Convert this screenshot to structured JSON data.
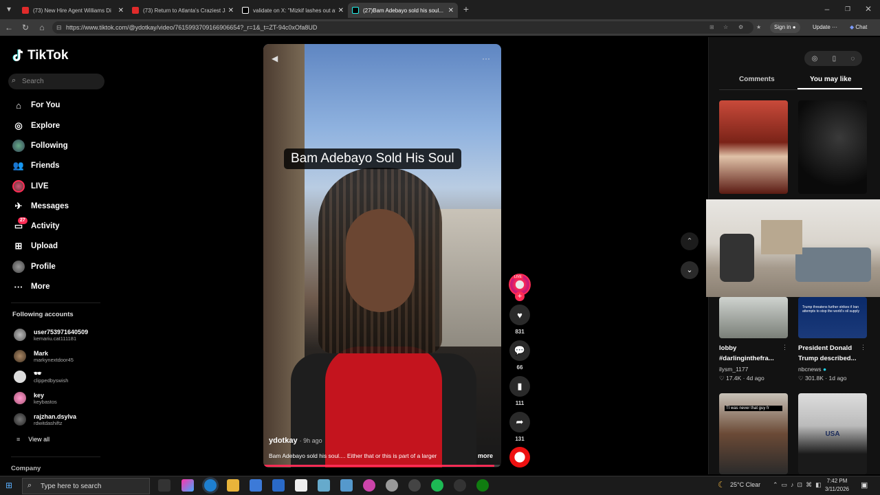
{
  "browser": {
    "tabs": [
      {
        "label": "(73) New Hire Agent Williams Di",
        "color": "#e02b2b"
      },
      {
        "label": "(73) Return to Atlanta's Craziest Ja",
        "color": "#e02b2b"
      },
      {
        "label": "validate on X: \"Mizkif lashes out at",
        "color": "#ffffff"
      },
      {
        "label": "(27)Bam Adebayo sold his soul...",
        "color": "#25f4ee"
      }
    ],
    "url": "https://www.tiktok.com/@ydotkay/video/7615993709166906654?_r=1&_t=ZT-94c0xOfa8UD",
    "signin": "Sign in",
    "update": "Update",
    "chat": "Chat"
  },
  "sidebar": {
    "logo": "TikTok",
    "search_placeholder": "Search",
    "nav": [
      {
        "label": "For You",
        "icon": "home-icon"
      },
      {
        "label": "Explore",
        "icon": "compass-icon"
      },
      {
        "label": "Following",
        "icon": "following-avatar-icon"
      },
      {
        "label": "Friends",
        "icon": "friends-icon"
      },
      {
        "label": "LIVE",
        "icon": "live-icon"
      },
      {
        "label": "Messages",
        "icon": "messages-icon"
      },
      {
        "label": "Activity",
        "icon": "activity-icon",
        "badge": "27"
      },
      {
        "label": "Upload",
        "icon": "upload-icon"
      },
      {
        "label": "Profile",
        "icon": "profile-icon"
      },
      {
        "label": "More",
        "icon": "more-icon"
      }
    ],
    "following_title": "Following accounts",
    "accounts": [
      {
        "name": "user7539716405​09",
        "handle": "kemariu.cat111181"
      },
      {
        "name": "Mark",
        "handle": "markynextdoor45"
      },
      {
        "name": "🕶",
        "handle": "clippedbyswish"
      },
      {
        "name": "key",
        "handle": "keybastos"
      },
      {
        "name": "rajzhan.dsylva",
        "handle": "rdwitdashiftz"
      }
    ],
    "view_all": "View all",
    "company": "Company"
  },
  "video": {
    "caption_overlay": "Bam Adebayo Sold His Soul",
    "author": "ydotkay",
    "time": "· 9h ago",
    "description": "Bam Adebayo sold his soul.... Either that or this is part of a larger",
    "more": "more",
    "progress": 0.97
  },
  "actions": {
    "live_badge": "LIVE",
    "likes": "831",
    "comments": "66",
    "saves": "111",
    "shares": "131"
  },
  "right_panel": {
    "tab_comments": "Comments",
    "tab_you_may_like": "You may like",
    "cards": [
      {
        "title": "lobby #darlinginthefra...",
        "author": "ilysm_1177",
        "likes": "17.4K",
        "age": "4d ago"
      },
      {
        "title": "President Donald Trump described...",
        "author": "nbcnews",
        "likes": "301.8K",
        "age": "1d ago"
      }
    ],
    "thumb_text_1": "Trump threatens further strikes if Iran attempts to stop the world's oil supply",
    "thumb_text_2": "TI was never that guy fr",
    "thumb_text_3": "USA"
  },
  "taskbar": {
    "search_placeholder": "Type here to search",
    "weather": "25°C  Clear",
    "time": "7:42 PM",
    "date": "3/11/2026"
  }
}
